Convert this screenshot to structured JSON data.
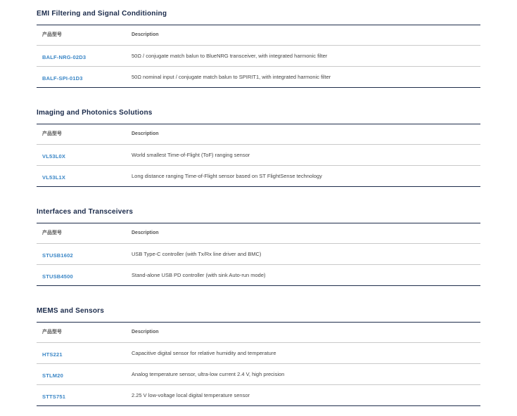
{
  "sections": [
    {
      "title": "EMI Filtering and Signal Conditioning",
      "header": {
        "part": "产品型号",
        "description": "Description"
      },
      "rows": [
        {
          "part": "BALF-NRG-02D3",
          "description": "50Ω / conjugate match balun to BlueNRG transceiver, with integrated harmonic filter"
        },
        {
          "part": "BALF-SPI-01D3",
          "description": "50Ω nominal input / conjugate match balun to SPIRIT1, with integrated harmonic filter"
        }
      ]
    },
    {
      "title": "Imaging and Photonics Solutions",
      "header": {
        "part": "产品型号",
        "description": "Description"
      },
      "rows": [
        {
          "part": "VL53L0X",
          "description": "World smallest Time-of-Flight (ToF) ranging sensor"
        },
        {
          "part": "VL53L1X",
          "description": "Long distance ranging Time-of-Flight sensor based on ST FlightSense technology"
        }
      ]
    },
    {
      "title": "Interfaces and Transceivers",
      "header": {
        "part": "产品型号",
        "description": "Description"
      },
      "rows": [
        {
          "part": "STUSB1602",
          "description": "USB Type-C controller (with Tx/Rx line driver and BMC)"
        },
        {
          "part": "STUSB4500",
          "description": "Stand-alone USB PD controller (with sink Auto-run mode)"
        }
      ]
    },
    {
      "title": "MEMS and Sensors",
      "header": {
        "part": "产品型号",
        "description": "Description"
      },
      "rows": [
        {
          "part": "HTS221",
          "description": "Capacitive digital sensor for relative humidity and temperature"
        },
        {
          "part": "STLM20",
          "description": "Analog temperature sensor, ultra-low current 2.4 V, high precision"
        },
        {
          "part": "STTS751",
          "description": "2.25 V low-voltage local digital temperature sensor"
        }
      ]
    }
  ]
}
